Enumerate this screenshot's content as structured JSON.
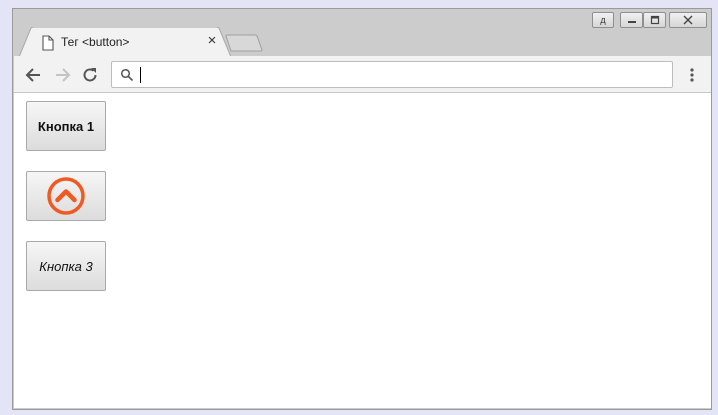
{
  "browser": {
    "tab_title": "Тег <button>",
    "tab_close": "×",
    "window_controls": {
      "user_label": "д",
      "minimize": "▭",
      "maximize": "◻",
      "close": "✕"
    },
    "address_bar": {
      "value": "",
      "placeholder": ""
    }
  },
  "page": {
    "buttons": [
      {
        "label": "Кнопка 1",
        "style": "bold"
      },
      {
        "label": "",
        "icon": "chevron-up-circle-icon",
        "icon_color": "#f05a22"
      },
      {
        "label": "Кнопка 3",
        "style": "italic"
      }
    ]
  },
  "colors": {
    "accent_icon": "#f05a22",
    "chrome_frame": "#cccccc",
    "toolbar": "#f2f2f2"
  }
}
